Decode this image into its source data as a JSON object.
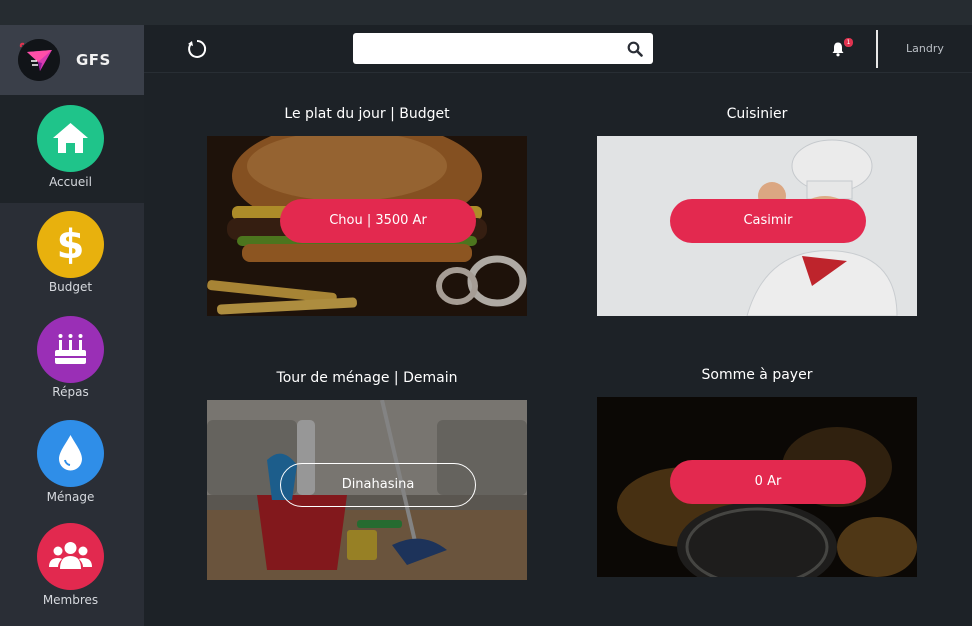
{
  "brand": {
    "name": "GFS",
    "logo_icon": "paper-plane-logo"
  },
  "sidebar": {
    "items": [
      {
        "label": "Accueil",
        "icon": "home-icon",
        "color": "#1fc48a",
        "active": true
      },
      {
        "label": "Budget",
        "icon": "dollar-icon",
        "color": "#e8b10d",
        "active": false
      },
      {
        "label": "Répas",
        "icon": "cake-icon",
        "color": "#9a2fb6",
        "active": false
      },
      {
        "label": "Ménage",
        "icon": "drop-icon",
        "color": "#2f8ee8",
        "active": false
      },
      {
        "label": "Membres",
        "icon": "users-icon",
        "color": "#e2294f",
        "active": false
      }
    ]
  },
  "header": {
    "search": {
      "placeholder": "",
      "value": ""
    },
    "notifications": {
      "count": "1"
    },
    "user": "Landry"
  },
  "cards": [
    {
      "title": "Le plat du jour | Budget",
      "button": "Chou | 3500 Ar",
      "image": "burger-photo"
    },
    {
      "title": "Cuisinier",
      "button": "Casimir",
      "image": "chef-photo"
    },
    {
      "title": "Tour de ménage | Demain",
      "button": "Dinahasina",
      "image": "cleaning-photo"
    },
    {
      "title": "Somme à payer",
      "button": "0 Ar",
      "image": "coins-photo"
    }
  ],
  "colors": {
    "accent": "#e3294f",
    "sidebar": "#2a2e36",
    "background": "#1d2227"
  }
}
